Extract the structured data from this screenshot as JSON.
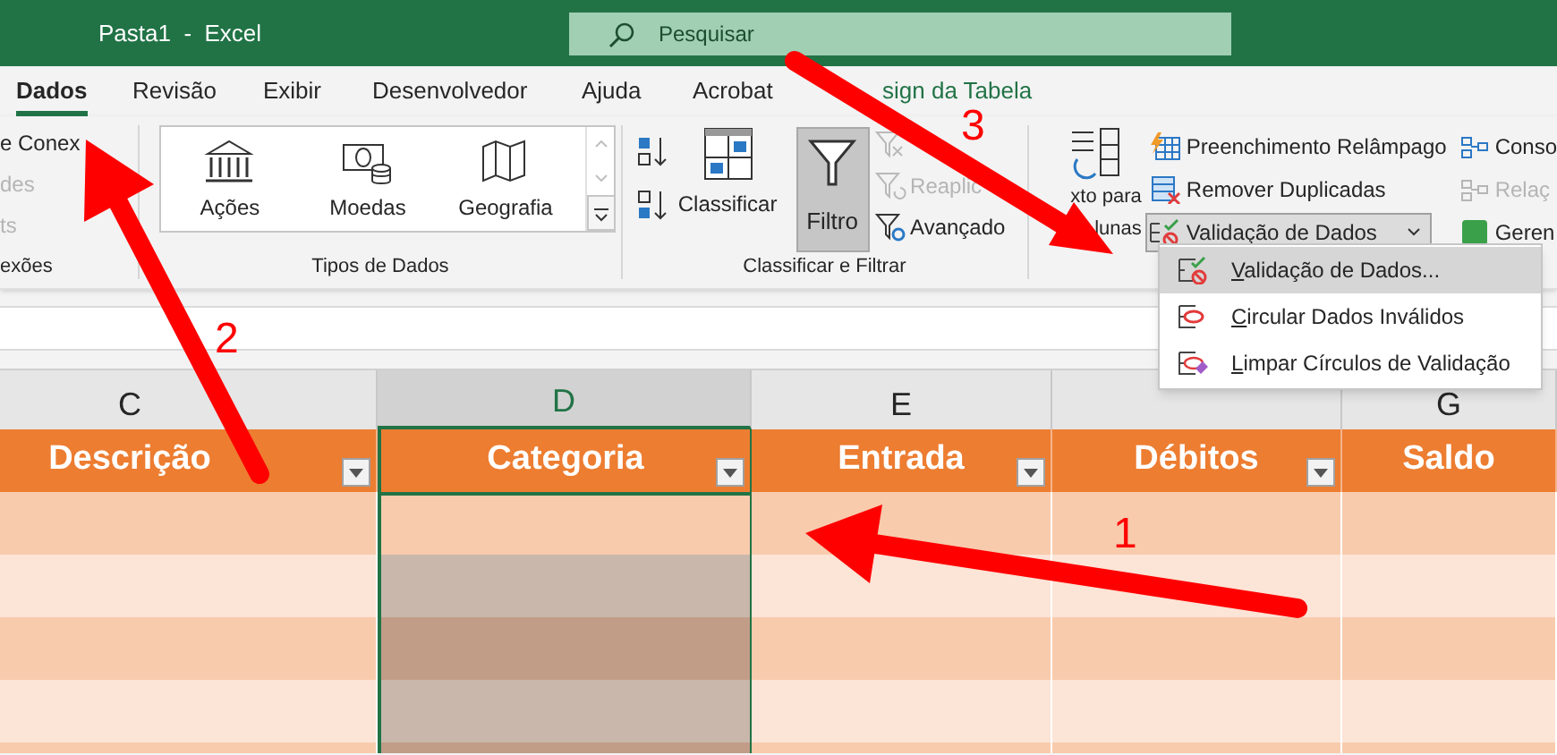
{
  "window": {
    "title": "Pasta1  -  Excel"
  },
  "search": {
    "placeholder": "Pesquisar"
  },
  "tabs": [
    {
      "label": "Dados",
      "selected": true,
      "kind": "normal"
    },
    {
      "label": "Revisão",
      "selected": false,
      "kind": "normal"
    },
    {
      "label": "Exibir",
      "selected": false,
      "kind": "normal"
    },
    {
      "label": "Desenvolvedor",
      "selected": false,
      "kind": "normal"
    },
    {
      "label": "Ajuda",
      "selected": false,
      "kind": "normal"
    },
    {
      "label": "Acrobat",
      "selected": false,
      "kind": "normal"
    },
    {
      "label": "sign da Tabela",
      "selected": false,
      "kind": "contextual"
    }
  ],
  "ribbon": {
    "connections": {
      "items": [
        {
          "label": "e Conex",
          "disabled": false
        },
        {
          "label": "des",
          "disabled": true
        },
        {
          "label": "ts",
          "disabled": true
        }
      ],
      "label": "exões"
    },
    "data_types": {
      "items": [
        "Ações",
        "Moedas",
        "Geografia"
      ],
      "label": "Tipos de Dados"
    },
    "sort_filter": {
      "sort_label": "Classificar",
      "filter": {
        "label": "Filtro",
        "pressed": true
      },
      "items": [
        {
          "disabled": true
        },
        {
          "label": "Reaplic",
          "disabled": true
        },
        {
          "label": "Avançado",
          "disabled": false
        }
      ],
      "label": "Classificar e Filtrar"
    },
    "data_tools": {
      "text_to_columns": [
        "xto para",
        "lunas"
      ],
      "items": [
        {
          "label": "Preenchimento Relâmpago",
          "pressed": false
        },
        {
          "label": "Remover Duplicadas",
          "pressed": false
        },
        {
          "label": "Validação de Dados",
          "pressed": true
        }
      ],
      "more": [
        {
          "label": "Conso",
          "disabled": false
        },
        {
          "label": "Relaç",
          "disabled": true
        },
        {
          "label": "Geren",
          "disabled": false
        }
      ]
    }
  },
  "validation_menu": [
    {
      "label": "Validação de Dados...",
      "selected": true
    },
    {
      "label": "Circular Dados Inválidos",
      "selected": false
    },
    {
      "label": "Limpar Círculos de Validação",
      "selected": false
    }
  ],
  "columns": [
    {
      "letter": "C",
      "selected": false
    },
    {
      "letter": "D",
      "selected": true
    },
    {
      "letter": "E",
      "selected": false
    },
    {
      "selected": false
    },
    {
      "letter": "G",
      "selected": false
    }
  ],
  "table": {
    "headers": [
      {
        "label": "Descrição",
        "filter": true
      },
      {
        "label": "Categoria",
        "filter": true
      },
      {
        "label": "Entrada",
        "filter": true
      },
      {
        "label": "Débitos",
        "filter": true
      },
      {
        "label": "Saldo",
        "filter": false
      }
    ],
    "rows": [
      {
        "kind": "dark",
        "active": true
      },
      {
        "kind": "light",
        "active": false
      },
      {
        "kind": "dark",
        "active": false
      },
      {
        "kind": "light",
        "active": false
      },
      {
        "kind": "dark",
        "active": false
      }
    ]
  },
  "annotations": [
    {
      "label": "1"
    },
    {
      "label": "2"
    },
    {
      "label": "3"
    }
  ]
}
